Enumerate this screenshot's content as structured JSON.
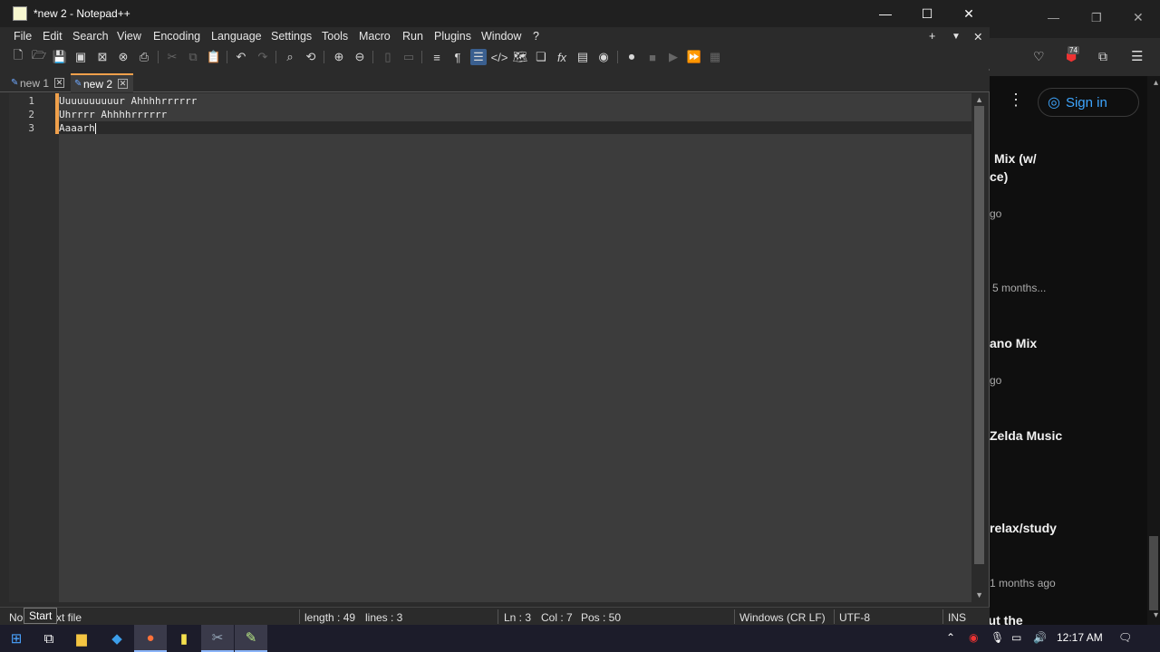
{
  "notepad": {
    "title": "*new 2 - Notepad++",
    "menu": [
      "File",
      "Edit",
      "Search",
      "View",
      "Encoding",
      "Language",
      "Settings",
      "Tools",
      "Macro",
      "Run",
      "Plugins",
      "Window",
      "?"
    ],
    "tabs": [
      {
        "label": "new 1",
        "active": false
      },
      {
        "label": "new 2",
        "active": true
      }
    ],
    "lines": [
      "Uuuuuuuuuur Ahhhhrrrrrr",
      "Uhrrrr Ahhhhrrrrrr",
      "Aaaarh"
    ],
    "line_numbers": [
      "1",
      "2",
      "3"
    ],
    "status": {
      "file_type": "Normal text file",
      "length": "length : 49",
      "lines": "lines : 3",
      "ln": "Ln : 3",
      "col": "Col : 7",
      "pos": "Pos : 50",
      "eol": "Windows (CR LF)",
      "encoding": "UTF-8",
      "mode": "INS"
    },
    "tooltip": "Start"
  },
  "browser": {
    "signin": "Sign in",
    "notification_count": "74",
    "items": [
      {
        "title": "Mix (w/",
        "title2": "ce)",
        "sub": "go"
      },
      {
        "sub": "5 months..."
      },
      {
        "title": "ano Mix",
        "sub": "go"
      },
      {
        "title": "Zelda Music"
      },
      {
        "title": "relax/study",
        "sub": "1 months ago"
      },
      {
        "title": "out the"
      }
    ]
  },
  "taskbar": {
    "time": "12:17 AM"
  },
  "colors": {
    "accent": "#f0a04b",
    "editor_bg": "#3c3c3c"
  }
}
